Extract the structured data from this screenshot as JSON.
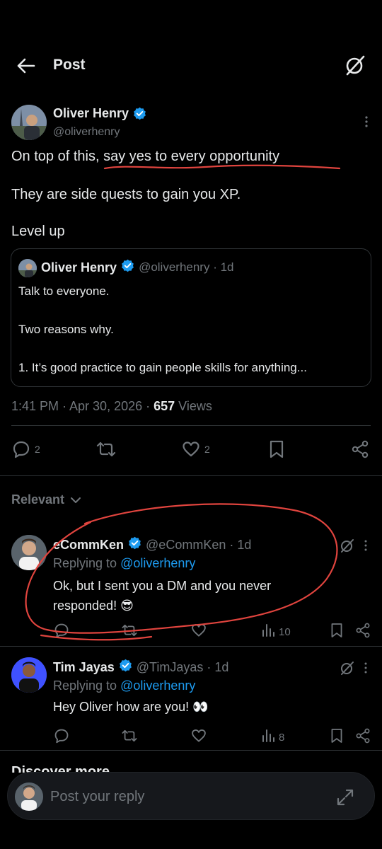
{
  "header": {
    "title": "Post"
  },
  "post": {
    "author_name": "Oliver Henry",
    "author_handle": "@oliverhenry",
    "lines": [
      "On top of this, say yes to every opportunity",
      "They are side quests to gain you XP.",
      "Level up"
    ],
    "quote": {
      "author_name": "Oliver Henry",
      "author_handle_time": "@oliverhenry · 1d",
      "lines": [
        "Talk to everyone.",
        "Two reasons why.",
        "1. It’s good practice to gain people skills for anything..."
      ]
    },
    "timestamp": "1:41 PM · Apr 30, 2026 · ",
    "views_count": "657",
    "views_label": " Views",
    "actions": {
      "replies": "2",
      "likes": "2"
    }
  },
  "relevant_label": "Relevant",
  "replies": [
    {
      "author_name": "eCommKen",
      "author_handle_time": "@eCommKen · 1d",
      "replying_prefix": "Replying to ",
      "replying_to": "@oliverhenry",
      "lines": [
        "Ok, but I sent you a DM and you never",
        "responded! 😎"
      ],
      "views": "10"
    },
    {
      "author_name": "Tim Jayas",
      "author_handle_time": "@TimJayas · 1d",
      "replying_prefix": "Replying to ",
      "replying_to": "@oliverhenry",
      "lines": [
        "Hey Oliver how are you! 👀"
      ],
      "views": "8"
    }
  ],
  "discover_partial": "Discover more",
  "compose": {
    "placeholder": "Post your reply"
  },
  "colors": {
    "accent": "#1d9bf0",
    "annotation": "#e0443e",
    "muted": "#71767b"
  },
  "icons": [
    "back-arrow-icon",
    "grok-icon",
    "verified-icon",
    "more-icon",
    "reply-icon",
    "retweet-icon",
    "like-icon",
    "bookmark-icon",
    "share-icon",
    "views-icon",
    "expand-icon",
    "chevron-down-icon"
  ]
}
